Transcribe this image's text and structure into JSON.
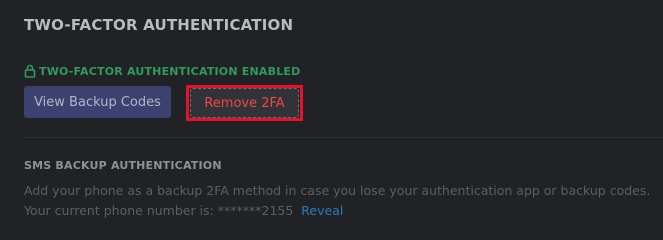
{
  "section": {
    "title": "TWO-FACTOR AUTHENTICATION"
  },
  "status": {
    "icon": "lock-icon",
    "text": "TWO-FACTOR AUTHENTICATION ENABLED",
    "color": "#2f9c5b"
  },
  "buttons": {
    "view_backup_codes": "View Backup Codes",
    "remove_2fa": "Remove 2FA"
  },
  "sms": {
    "title": "SMS BACKUP AUTHENTICATION",
    "description": "Add your phone as a backup 2FA method in case you lose your authentication app or backup codes.",
    "phone_prefix": "Your current phone number is: *******2155",
    "link": "Reveal"
  },
  "colors": {
    "background": "#202225",
    "accent_button": "#3b4270",
    "danger": "#f04747",
    "highlight": "#e8102a"
  }
}
